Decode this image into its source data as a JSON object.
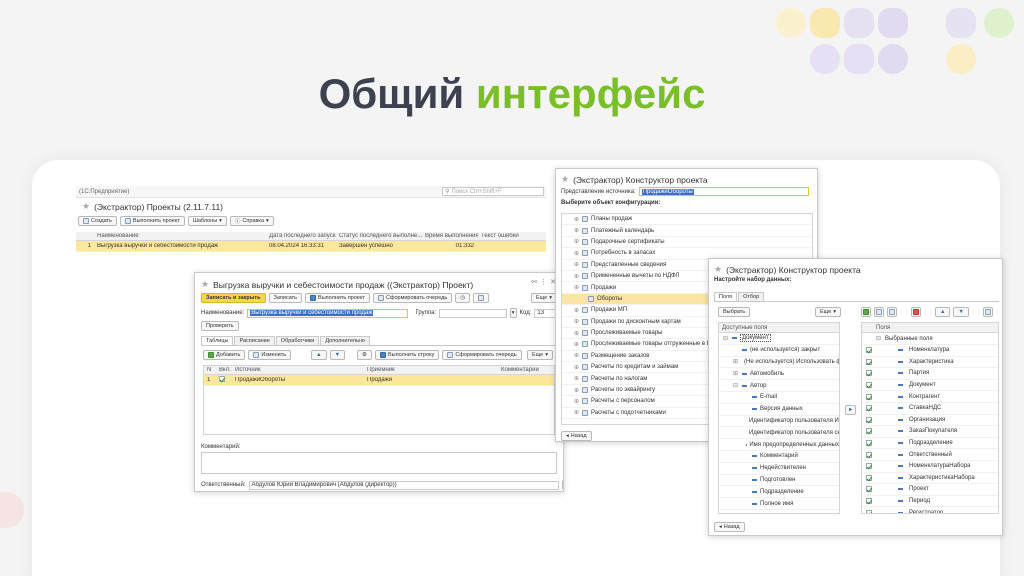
{
  "slide": {
    "title_main": "Общий",
    "title_accent": "интерфейс",
    "colors": {
      "title": "#3d4150",
      "accent": "#7bbf28"
    }
  },
  "projects_window": {
    "app_label": "(1С:Предприятие)",
    "search_placeholder": "Поиск Ctrl+Shift+F",
    "title": "(Экстрактор) Проекты (2.11.7.11)",
    "toolbar": {
      "create": "Создать",
      "run": "Выполнить проект",
      "templates": "Шаблоны",
      "help": "Справка"
    },
    "columns": [
      "Наименование",
      "Дата последнего запуска",
      "Статус последнего выполне...",
      "Время выполнения",
      "Текст ошибки"
    ],
    "rows": [
      {
        "num": "1",
        "name": "Выгрузка выручки и себестоимости продаж",
        "date": "08.04.2024 16:33:31",
        "status": "Завершен успешно",
        "time": "01:332",
        "error": ""
      }
    ]
  },
  "project_form": {
    "title": "Выгрузка выручки и себестоимости продаж ((Экстрактор) Проект)",
    "toolbar": {
      "save_close": "Записать и закрыть",
      "save": "Записать",
      "run": "Выполнить проект",
      "queue": "Сформировать очередь",
      "more": "Еще"
    },
    "name_label": "Наименование:",
    "name_value": "Выгрузка выручки и себестоимости продаж",
    "group_label": "Группа:",
    "code_label": "Код:",
    "code_value": "13",
    "check_button": "Проверить",
    "tabs": [
      "Таблицы",
      "Расписание",
      "Обработчики",
      "Дополнительно"
    ],
    "table_toolbar": {
      "add": "Добавить",
      "edit": "Изменить",
      "run_row": "Выполнить строку",
      "queue": "Сформировать очередь",
      "more": "Еще"
    },
    "columns": [
      "N",
      "Вкл.",
      "Источник",
      "Приемник",
      "Комментарий"
    ],
    "rows": [
      {
        "num": "1",
        "enabled": true,
        "source": "ПродажиОбороты",
        "target": "Продажи",
        "comment": ""
      }
    ],
    "comment_label": "Комментарий:",
    "responsible_label": "Ответственный:",
    "responsible_value": "Абдулов Юрий Владимирович (Абдулов (директор))"
  },
  "constructor_1": {
    "title": "(Экстрактор) Конструктор проекта",
    "source_label": "Представление источника:",
    "source_value": "ПродажиОбороты",
    "choose_label": "Выберите объект конфигурации:",
    "items": [
      {
        "label": "Планы продаж",
        "selected": false,
        "child": false
      },
      {
        "label": "Платежный календарь",
        "selected": false,
        "child": false
      },
      {
        "label": "Подарочные сертификаты",
        "selected": false,
        "child": false
      },
      {
        "label": "Потребность в запасах",
        "selected": false,
        "child": false
      },
      {
        "label": "Представленные сведения",
        "selected": false,
        "child": false
      },
      {
        "label": "Примененные вычеты по НДФЛ",
        "selected": false,
        "child": false
      },
      {
        "label": "Продажи",
        "selected": false,
        "child": false
      },
      {
        "label": "Обороты",
        "selected": true,
        "child": true
      },
      {
        "label": "Продажи МП",
        "selected": false,
        "child": false
      },
      {
        "label": "Продажи по дисконтным картам",
        "selected": false,
        "child": false
      },
      {
        "label": "Прослеживаемые товары",
        "selected": false,
        "child": false
      },
      {
        "label": "Прослеживаемые товары отгруженные в ЕАЭС",
        "selected": false,
        "child": false
      },
      {
        "label": "Размещение заказов",
        "selected": false,
        "child": false
      },
      {
        "label": "Расчеты по кредитам и займам",
        "selected": false,
        "child": false
      },
      {
        "label": "Расчеты по налогам",
        "selected": false,
        "child": false
      },
      {
        "label": "Расчеты по эквайрингу",
        "selected": false,
        "child": false
      },
      {
        "label": "Расчеты с персоналом",
        "selected": false,
        "child": false
      },
      {
        "label": "Расчеты с подотчетниками",
        "selected": false,
        "child": false
      }
    ],
    "back": "Назад"
  },
  "constructor_2": {
    "title": "(Экстрактор) Конструктор проекта",
    "setup_label": "Настройте набор данных:",
    "tabs": [
      "Поля",
      "Отбор"
    ],
    "choose_button": "Выбрать",
    "more": "Еще",
    "left_header": "Доступные поля",
    "left_items": [
      {
        "label": "Документ",
        "level": 0,
        "tree": "⊟",
        "selected": true
      },
      {
        "label": "(не используется) закрыт",
        "level": 1,
        "tree": "",
        "selected": false
      },
      {
        "label": "(Не используется) Использовать фо",
        "level": 1,
        "tree": "⊞",
        "selected": false
      },
      {
        "label": "Автомобиль",
        "level": 1,
        "tree": "⊞",
        "selected": false
      },
      {
        "label": "Автор",
        "level": 1,
        "tree": "⊟",
        "selected": false
      },
      {
        "label": "E-mail",
        "level": 2,
        "tree": "",
        "selected": false
      },
      {
        "label": "Версия данных",
        "level": 2,
        "tree": "",
        "selected": false
      },
      {
        "label": "Идентификатор пользователя ИБ",
        "level": 2,
        "tree": "",
        "selected": false
      },
      {
        "label": "Идентификатор пользователя се",
        "level": 2,
        "tree": "",
        "selected": false
      },
      {
        "label": "Имя предопределенных данных",
        "level": 2,
        "tree": "",
        "selected": false
      },
      {
        "label": "Комментарий",
        "level": 2,
        "tree": "",
        "selected": false
      },
      {
        "label": "Недействителен",
        "level": 2,
        "tree": "",
        "selected": false
      },
      {
        "label": "Подготовлен",
        "level": 2,
        "tree": "",
        "selected": false
      },
      {
        "label": "Подразделение",
        "level": 2,
        "tree": "",
        "selected": false
      },
      {
        "label": "Полное имя",
        "level": 2,
        "tree": "",
        "selected": false
      }
    ],
    "right_header": "Поля",
    "right_group": "Выбранные поля",
    "right_items": [
      "Номенклатура",
      "Характеристика",
      "Партия",
      "Документ",
      "Контрагент",
      "СтавкаНДС",
      "Организация",
      "ЗаказПокупателя",
      "Подразделение",
      "Ответственный",
      "НоменклатураНабора",
      "ХарактеристикаНабора",
      "Проект",
      "Период",
      "Регистратор"
    ],
    "back": "Назад"
  }
}
